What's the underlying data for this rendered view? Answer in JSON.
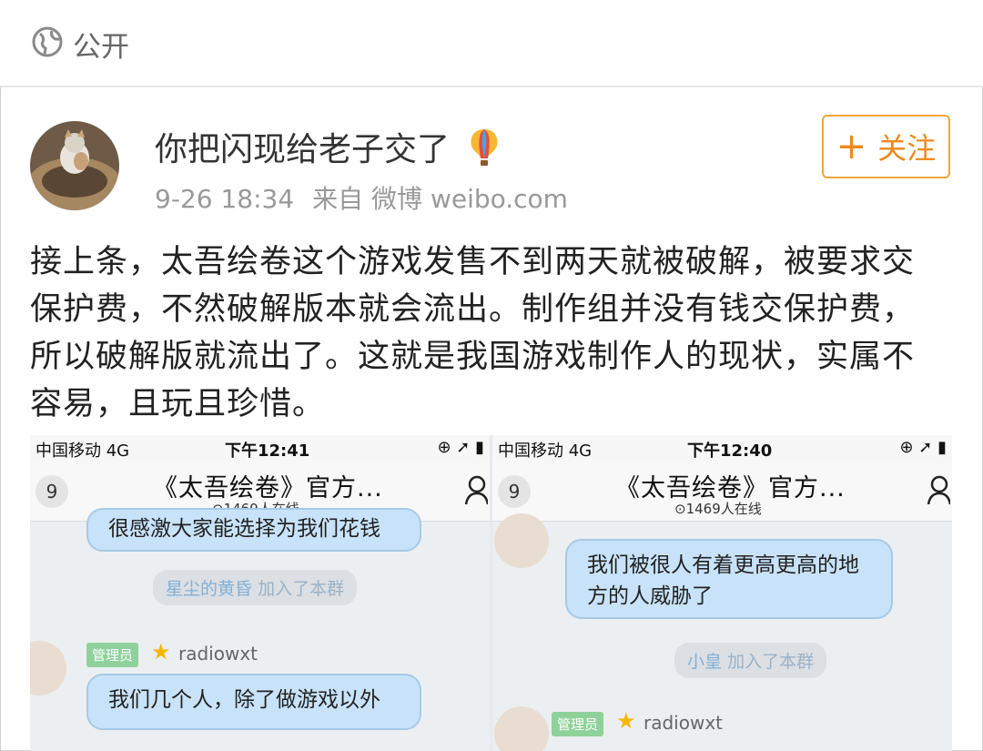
{
  "header": {
    "visibility_label": "公开"
  },
  "post": {
    "username": "你把闪现给老子交了",
    "time": "9-26 18:34",
    "source": "来自 微博 weibo.com",
    "follow_label": "关注",
    "text": "接上条，太吾绘卷这个游戏发售不到两天就被破解，被要求交保护费，不然破解版本就会流出。制作组并没有钱交保护费，所以破解版就流出了。这就是我国游戏制作人的现状，实属不容易，且玩且珍惜。"
  },
  "screenshot": {
    "left": {
      "carrier": "中国移动 4G",
      "time": "下午12:41",
      "badge": "9",
      "group_title": "《太吾绘卷》官方...",
      "online": "⊙1469人在线",
      "top_msg": "很感激大家能选择为我们花钱",
      "join_name": "星尘的黄昏",
      "join_text": "加入了本群",
      "admin_tag": "管理员",
      "admin_name": "radiowxt",
      "msg2": "我们几个人，除了做游戏以外"
    },
    "right": {
      "carrier": "中国移动 4G",
      "time": "下午12:40",
      "badge": "9",
      "group_title": "《太吾绘卷》官方...",
      "online": "⊙1469人在线",
      "msg1": "我们被很人有着更高更高的地方的人威胁了",
      "join_name": "小皇",
      "join_text": "加入了本群",
      "admin_tag": "管理员",
      "admin_name": "radiowxt"
    }
  },
  "colors": {
    "accent": "#ee8a1d",
    "bubble": "#c8e3f9"
  }
}
